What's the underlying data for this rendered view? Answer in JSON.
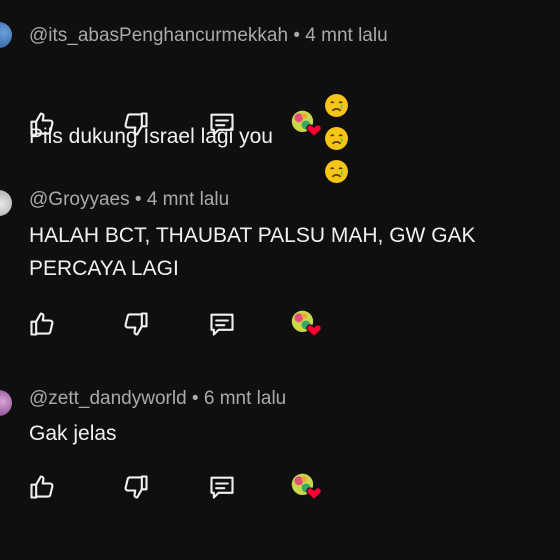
{
  "comments": [
    {
      "handle": "@its_abasPenghancurmekkah",
      "time": "4 mnt lalu",
      "text": "Pils dukung Israel lagi you",
      "emojis": [
        "crying-face-emoji",
        "crying-face-emoji",
        "crying-face-emoji"
      ]
    },
    {
      "handle": "@Groyyaes",
      "time": "4 mnt lalu",
      "text": "HALAH BCT, THAUBAT PALSU MAH, GW GAK\nPERCAYA LAGI",
      "emojis": []
    },
    {
      "handle": "@zett_dandyworld",
      "time": "6 mnt lalu",
      "text": "Gak jelas",
      "emojis": []
    }
  ],
  "meta_separator": " • ",
  "icons": {
    "like": "thumbs-up-icon",
    "dislike": "thumbs-down-icon",
    "reply": "reply-comment-icon",
    "creator_heart": "creator-heart-icon"
  },
  "colors": {
    "background": "#0f0f0f",
    "text": "#f1f1f1",
    "meta": "#aaaaaa",
    "heart": "#ff0033"
  }
}
